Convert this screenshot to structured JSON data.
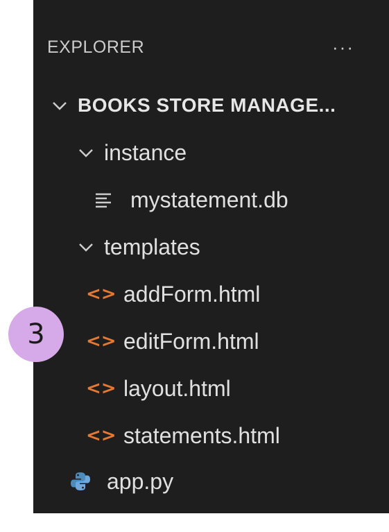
{
  "explorer": {
    "title": "EXPLORER",
    "more_label": "···",
    "root": {
      "label": "BOOKS STORE MANAGE..."
    },
    "folders": {
      "instance": {
        "label": "instance"
      },
      "templates": {
        "label": "templates"
      }
    },
    "files": {
      "db": {
        "label": "mystatement.db",
        "icon": "database-file-icon"
      },
      "addForm": {
        "label": "addForm.html",
        "icon": "html-file-icon"
      },
      "editForm": {
        "label": "editForm.html",
        "icon": "html-file-icon"
      },
      "layout": {
        "label": "layout.html",
        "icon": "html-file-icon"
      },
      "statements": {
        "label": "statements.html",
        "icon": "html-file-icon"
      },
      "app": {
        "label": "app.py",
        "icon": "python-file-icon"
      }
    }
  },
  "badge": {
    "label": "3"
  },
  "colors": {
    "background": "#1e1e1e",
    "text": "#e0e0e0",
    "html_icon": "#e37933",
    "python_icon": "#4b8bbe",
    "badge": "#d6a9e8"
  }
}
